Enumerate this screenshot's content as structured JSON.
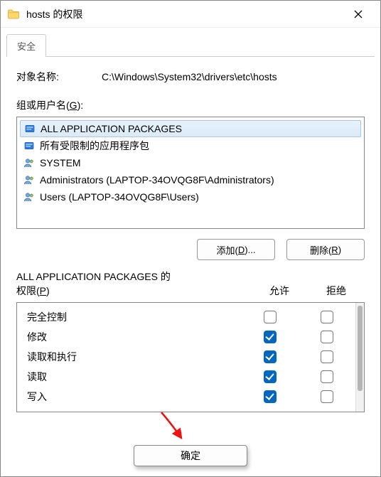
{
  "window": {
    "title": "hosts 的权限"
  },
  "tabs": {
    "security": "安全"
  },
  "object": {
    "label": "对象名称:",
    "value": "C:\\Windows\\System32\\drivers\\etc\\hosts"
  },
  "groups": {
    "label_pre": "组或用户名(",
    "label_key": "G",
    "label_post": "):",
    "items": [
      {
        "name": "ALL APPLICATION PACKAGES",
        "icon": "package",
        "selected": true
      },
      {
        "name": "所有受限制的应用程序包",
        "icon": "package",
        "selected": false
      },
      {
        "name": "SYSTEM",
        "icon": "users",
        "selected": false
      },
      {
        "name": "Administrators (LAPTOP-34OVQG8F\\Administrators)",
        "icon": "users",
        "selected": false
      },
      {
        "name": "Users (LAPTOP-34OVQG8F\\Users)",
        "icon": "users",
        "selected": false
      }
    ]
  },
  "buttons": {
    "add_pre": "添加(",
    "add_key": "D",
    "add_post": ")...",
    "remove_pre": "删除(",
    "remove_key": "R",
    "remove_post": ")",
    "ok": "确定"
  },
  "perm_header": {
    "label_line1": "ALL APPLICATION PACKAGES 的",
    "label_line2_pre": "权限(",
    "label_line2_key": "P",
    "label_line2_post": ")",
    "allow": "允许",
    "deny": "拒绝"
  },
  "permissions": [
    {
      "name": "完全控制",
      "allow": false,
      "deny": false
    },
    {
      "name": "修改",
      "allow": true,
      "deny": false
    },
    {
      "name": "读取和执行",
      "allow": true,
      "deny": false
    },
    {
      "name": "读取",
      "allow": true,
      "deny": false
    },
    {
      "name": "写入",
      "allow": true,
      "deny": false
    }
  ]
}
